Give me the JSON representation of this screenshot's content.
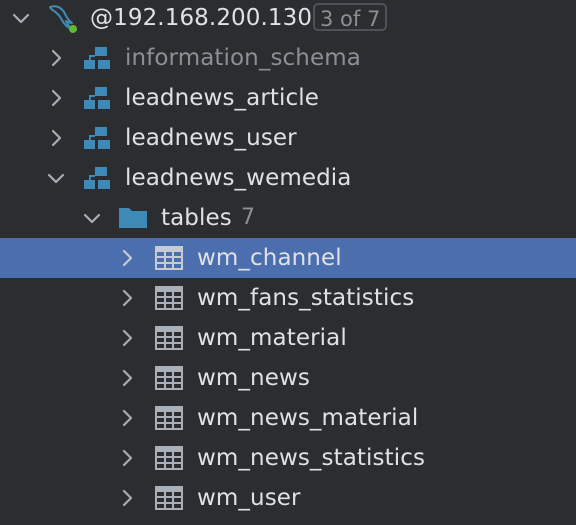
{
  "connection": {
    "label": "@192.168.200.130",
    "badge": "3 of 7",
    "icon": "mysql-dolphin-icon"
  },
  "schemas": [
    {
      "name": "information_schema",
      "muted": true,
      "expanded": false
    },
    {
      "name": "leadnews_article",
      "muted": false,
      "expanded": false
    },
    {
      "name": "leadnews_user",
      "muted": false,
      "expanded": false
    },
    {
      "name": "leadnews_wemedia",
      "muted": false,
      "expanded": true
    }
  ],
  "tables_folder": {
    "label": "tables",
    "count": "7"
  },
  "tables": [
    {
      "name": "wm_channel",
      "selected": true
    },
    {
      "name": "wm_fans_statistics",
      "selected": false
    },
    {
      "name": "wm_material",
      "selected": false
    },
    {
      "name": "wm_news",
      "selected": false
    },
    {
      "name": "wm_news_material",
      "selected": false
    },
    {
      "name": "wm_news_statistics",
      "selected": false
    },
    {
      "name": "wm_user",
      "selected": false
    }
  ],
  "colors": {
    "background": "#2b2d30",
    "selection": "#4b6eaf",
    "text": "#dfe1e5",
    "muted_text": "#8c8f94",
    "schema_icon": "#3d8ab7",
    "folder_icon": "#3d8ab7",
    "table_icon": "#a9b0b8",
    "online_dot": "#5fb832"
  }
}
